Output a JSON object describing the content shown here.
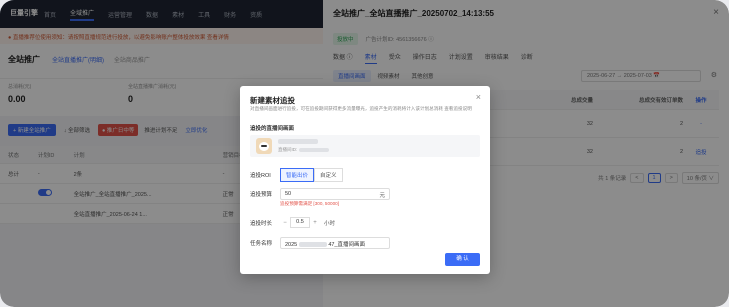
{
  "background": {
    "topnav": {
      "logo": "巨量引擎",
      "items": [
        "首页",
        "全域推广",
        "运营管理",
        "数据",
        "素材",
        "工具",
        "财务",
        "资质"
      ],
      "active_index": 1
    },
    "notice": "● 直播推荐位使用须知：请按照直播规范进行投放，以避免影响账户整体投放效果   查看详情",
    "page_title": "全站推广",
    "subtabs": [
      "全站直播推广(明细)",
      "全站商品推广"
    ],
    "stats": [
      {
        "label": "总消耗(元)",
        "value": "0.00"
      },
      {
        "label": "全站直播推广消耗(元)",
        "value": "0"
      }
    ],
    "toolbar": {
      "create": "+ 新建全站推广",
      "filter": "↓ 全部筛选",
      "warn": "● 推广日中等",
      "tip": "推进计划不足",
      "link": "立即优化"
    },
    "table_head": [
      "状态",
      "计划ID",
      "计划",
      "营销目标",
      ""
    ],
    "table_rows": [
      {
        "c1": "总计",
        "c2": "-",
        "c3": "2条",
        "c4": "-",
        "c5": "-"
      },
      {
        "c1": "",
        "c2": "",
        "c3": "全站推广_全站直播推广_2025...",
        "c4": "正常",
        "c5": ""
      },
      {
        "c1": "",
        "c2": "",
        "c3": "全站直播推广_2025-06-24 1...",
        "c4": "正常",
        "c5": ""
      }
    ]
  },
  "drawer": {
    "title": "全站推广_全站直播推广_20250702_14:13:55",
    "close_icon": "×",
    "status_badge": "投放中",
    "meta": "广告计划ID: 4561356676 ⓘ",
    "tabs": [
      "数据 ⓘ",
      "素材",
      "受众",
      "操作日志",
      "计划设置",
      "审核结果",
      "诊断"
    ],
    "active_tab": 1,
    "subtabs": [
      "直播间画面",
      "视频素材",
      "其他创意"
    ],
    "active_subtab": 0,
    "daterange": "2025-06-27   →   2025-07-03   📅",
    "table_head": [
      "",
      "总成交量",
      "总成交有效订单数",
      "操作"
    ],
    "rows": [
      {
        "name": "",
        "a": "32",
        "b": "2",
        "op": "-"
      },
      {
        "name": "",
        "a": "32",
        "b": "2",
        "op": "追投"
      }
    ],
    "pager": {
      "total": "共 1 条记录",
      "prev": "<",
      "page": "1",
      "next": ">",
      "size": "10 条/页 ∨"
    }
  },
  "modal": {
    "title": "新建素材追投",
    "close_icon": "×",
    "desc": "对直播间画面进行追投，可在追投期间获得更多流量曝光，追投产生的消耗将计入该计划总消耗   查看追投说明",
    "desc_link": "查看追投说明",
    "section_label": "追投的直播间画面",
    "scene_id_label": "直播间ID:",
    "roi_label": "追投ROI",
    "roi_options": [
      "智能出价",
      "自定义"
    ],
    "roi_active": 0,
    "budget_label": "追投预算",
    "budget_value": "50",
    "budget_unit": "元",
    "budget_error": "追投预算需满足 [300, 50000]",
    "duration_label": "追投时长",
    "duration_minus": "−",
    "duration_value": "0.5",
    "duration_plus": "+",
    "duration_unit": "小时",
    "taskname_label": "任务名称",
    "taskname_prefix": "2025",
    "taskname_suffix": "47_直播间画面",
    "confirm": "确 认"
  }
}
